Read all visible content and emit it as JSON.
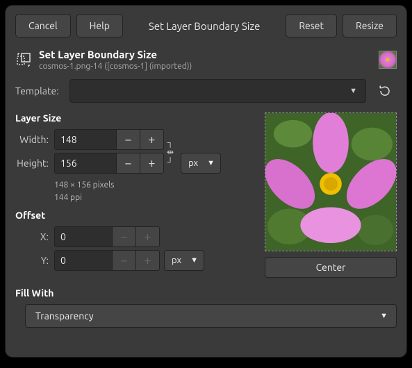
{
  "buttons": {
    "cancel": "Cancel",
    "help": "Help",
    "title": "Set Layer Boundary Size",
    "reset": "Reset",
    "resize": "Resize"
  },
  "header": {
    "title": "Set Layer Boundary Size",
    "subtitle": "cosmos-1.png-14 ([cosmos-1] (imported))"
  },
  "template": {
    "label": "Template:",
    "value": ""
  },
  "layer_size": {
    "label": "Layer Size",
    "width_label": "Width:",
    "height_label": "Height:",
    "width": "148",
    "height": "156",
    "unit": "px",
    "dims": "148 × 156 pixels",
    "ppi": "144 ppi"
  },
  "offset": {
    "label": "Offset",
    "x_label": "X:",
    "y_label": "Y:",
    "x": "0",
    "y": "0",
    "unit": "px",
    "center": "Center"
  },
  "fill": {
    "label": "Fill With",
    "value": "Transparency"
  }
}
